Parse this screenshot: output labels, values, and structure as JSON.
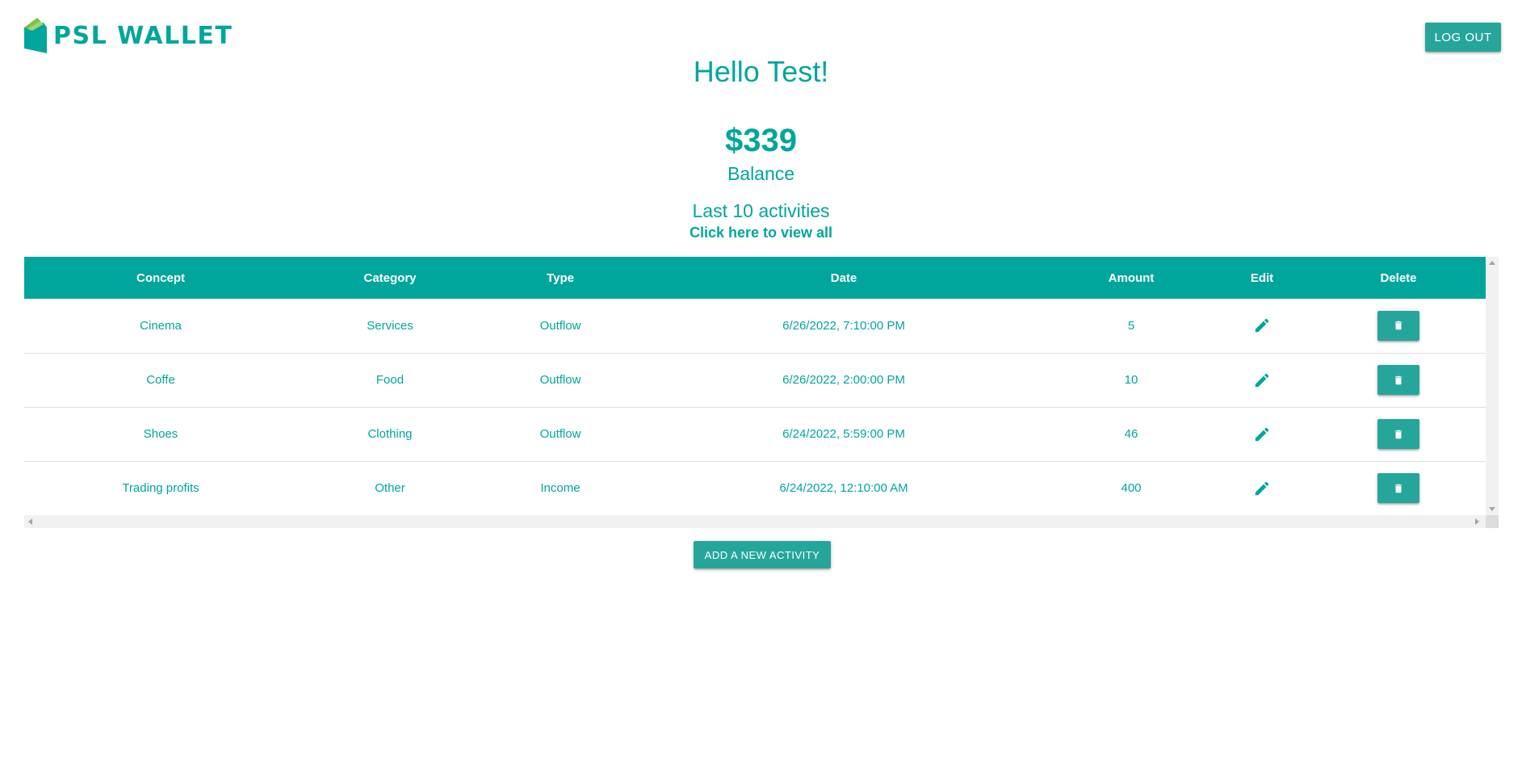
{
  "header": {
    "logo_text": "PSL WALLET",
    "logout_label": "LOG OUT"
  },
  "greeting": "Hello Test!",
  "balance": {
    "amount": "$339",
    "label": "Balance"
  },
  "activities": {
    "title": "Last 10 activities",
    "view_all_link": "Click here to view all"
  },
  "table": {
    "columns": [
      "Concept",
      "Category",
      "Type",
      "Date",
      "Amount",
      "Edit",
      "Delete"
    ],
    "rows": [
      {
        "concept": "Cinema",
        "category": "Services",
        "type": "Outflow",
        "date": "6/26/2022, 7:10:00 PM",
        "amount": "5"
      },
      {
        "concept": "Coffe",
        "category": "Food",
        "type": "Outflow",
        "date": "6/26/2022, 2:00:00 PM",
        "amount": "10"
      },
      {
        "concept": "Shoes",
        "category": "Clothing",
        "type": "Outflow",
        "date": "6/24/2022, 5:59:00 PM",
        "amount": "46"
      },
      {
        "concept": "Trading profits",
        "category": "Other",
        "type": "Income",
        "date": "6/24/2022, 12:10:00 AM",
        "amount": "400"
      }
    ],
    "edit_icon": "pencil-icon",
    "delete_icon": "trash-icon"
  },
  "add_button_label": "ADD A NEW ACTIVITY",
  "colors": {
    "brand": "#00a69b",
    "button": "#26a69a",
    "logo_accent": "#7dc242"
  }
}
